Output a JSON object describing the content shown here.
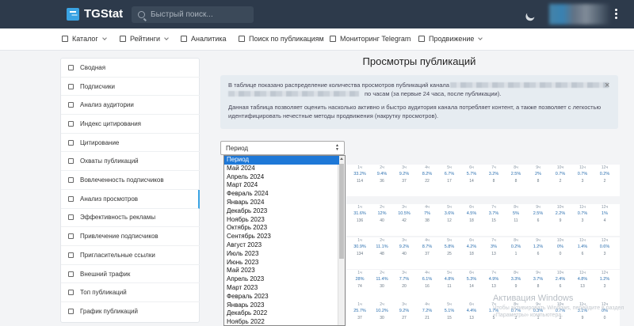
{
  "header": {
    "brand": "TGStat",
    "search_placeholder": "Быстрый поиск..."
  },
  "nav": [
    {
      "label": "Каталог",
      "has_dropdown": true
    },
    {
      "label": "Рейтинги",
      "has_dropdown": true
    },
    {
      "label": "Аналитика",
      "has_dropdown": false
    },
    {
      "label": "Поиск по публикациям",
      "has_dropdown": false
    },
    {
      "label": "Мониторинг Telegram",
      "has_dropdown": false
    },
    {
      "label": "Продвижение",
      "has_dropdown": true
    }
  ],
  "sidebar": {
    "items": [
      {
        "label": "Сводная"
      },
      {
        "label": "Подписчики"
      },
      {
        "label": "Анализ аудитории"
      },
      {
        "label": "Индекс цитирования"
      },
      {
        "label": "Цитирование"
      },
      {
        "label": "Охваты публикаций"
      },
      {
        "label": "Вовлеченность подписчиков"
      },
      {
        "label": "Анализ просмотров",
        "active": true
      },
      {
        "label": "Эффективность рекламы"
      },
      {
        "label": "Привлечение подписчиков"
      },
      {
        "label": "Пригласительные ссылки"
      },
      {
        "label": "Внешний трафик"
      },
      {
        "label": "Топ публикаций"
      },
      {
        "label": "График публикаций"
      }
    ]
  },
  "main": {
    "title": "Просмотры публикаций",
    "info": {
      "line1": "В таблице показано распределение количества просмотров публикаций канала",
      "line2": "по часам (за первые 24 часа, после публикации).",
      "line3": "Данная таблица позволяет оценить насколько активно и быстро аудитория канала потребляет контент, а также позволяет с легкостью",
      "line4": "идентифицировать нечестные методы продвижения (накрутку просмотров)."
    },
    "close_glyph": "×",
    "period_select": {
      "value": "Период",
      "options": [
        "Период",
        "Май 2024",
        "Апрель 2024",
        "Март 2024",
        "Февраль 2024",
        "Январь 2024",
        "Декабрь 2023",
        "Ноябрь 2023",
        "Октябрь 2023",
        "Сентябрь 2023",
        "Август 2023",
        "Июль 2023",
        "Июнь 2023",
        "Май 2023",
        "Апрель 2023",
        "Март 2023",
        "Февраль 2023",
        "Январь 2023",
        "Декабрь 2022",
        "Ноябрь 2022"
      ],
      "selected_index": 0
    }
  },
  "grid": {
    "hours": [
      "1ч",
      "2ч",
      "3ч",
      "4ч",
      "5ч",
      "6ч",
      "7ч",
      "8ч",
      "9ч",
      "10ч",
      "11ч",
      "12ч"
    ],
    "rows": [
      {
        "pct": [
          "33.2%",
          "9.4%",
          "9.2%",
          "8.2%",
          "6.7%",
          "5.7%",
          "3.2%",
          "2.5%",
          "2%",
          "0.7%",
          "0.7%",
          "0.2%"
        ],
        "views": [
          "114",
          "36",
          "37",
          "22",
          "17",
          "14",
          "8",
          "8",
          "8",
          "2",
          "3",
          "2"
        ]
      },
      {
        "pct": [
          "31.6%",
          "12%",
          "10.5%",
          "7%",
          "3.6%",
          "4.5%",
          "3.7%",
          "5%",
          "2.5%",
          "2.2%",
          "0.7%",
          "1%"
        ],
        "views": [
          "136",
          "40",
          "42",
          "38",
          "12",
          "18",
          "15",
          "11",
          "6",
          "9",
          "3",
          "4"
        ]
      },
      {
        "pct": [
          "30.9%",
          "11.1%",
          "9.2%",
          "8.7%",
          "5.8%",
          "4.2%",
          "3%",
          "0.2%",
          "1.2%",
          "0%",
          "1.4%",
          "0.6%"
        ],
        "views": [
          "134",
          "48",
          "40",
          "37",
          "25",
          "18",
          "13",
          "1",
          "6",
          "0",
          "6",
          "3"
        ]
      },
      {
        "pct": [
          "28%",
          "11.4%",
          "7.7%",
          "6.1%",
          "4.8%",
          "5.3%",
          "4.9%",
          "3.3%",
          "3.7%",
          "2.4%",
          "4.8%",
          "1.2%"
        ],
        "views": [
          "74",
          "30",
          "20",
          "16",
          "11",
          "14",
          "13",
          "9",
          "8",
          "6",
          "13",
          "3"
        ]
      },
      {
        "pct": [
          "25.7%",
          "10.2%",
          "9.2%",
          "7.2%",
          "5.1%",
          "4.4%",
          "1.7%",
          "0.7%",
          "0.3%",
          "0.7%",
          "3.1%",
          "0%"
        ],
        "views": [
          "37",
          "30",
          "27",
          "21",
          "15",
          "13",
          "5",
          "2",
          "1",
          "2",
          "9",
          "0"
        ]
      }
    ]
  },
  "watermark": {
    "title": "Активация Windows",
    "text": "Чтобы активировать Windows, перейдите в раздел «Параметры» компьютера."
  }
}
